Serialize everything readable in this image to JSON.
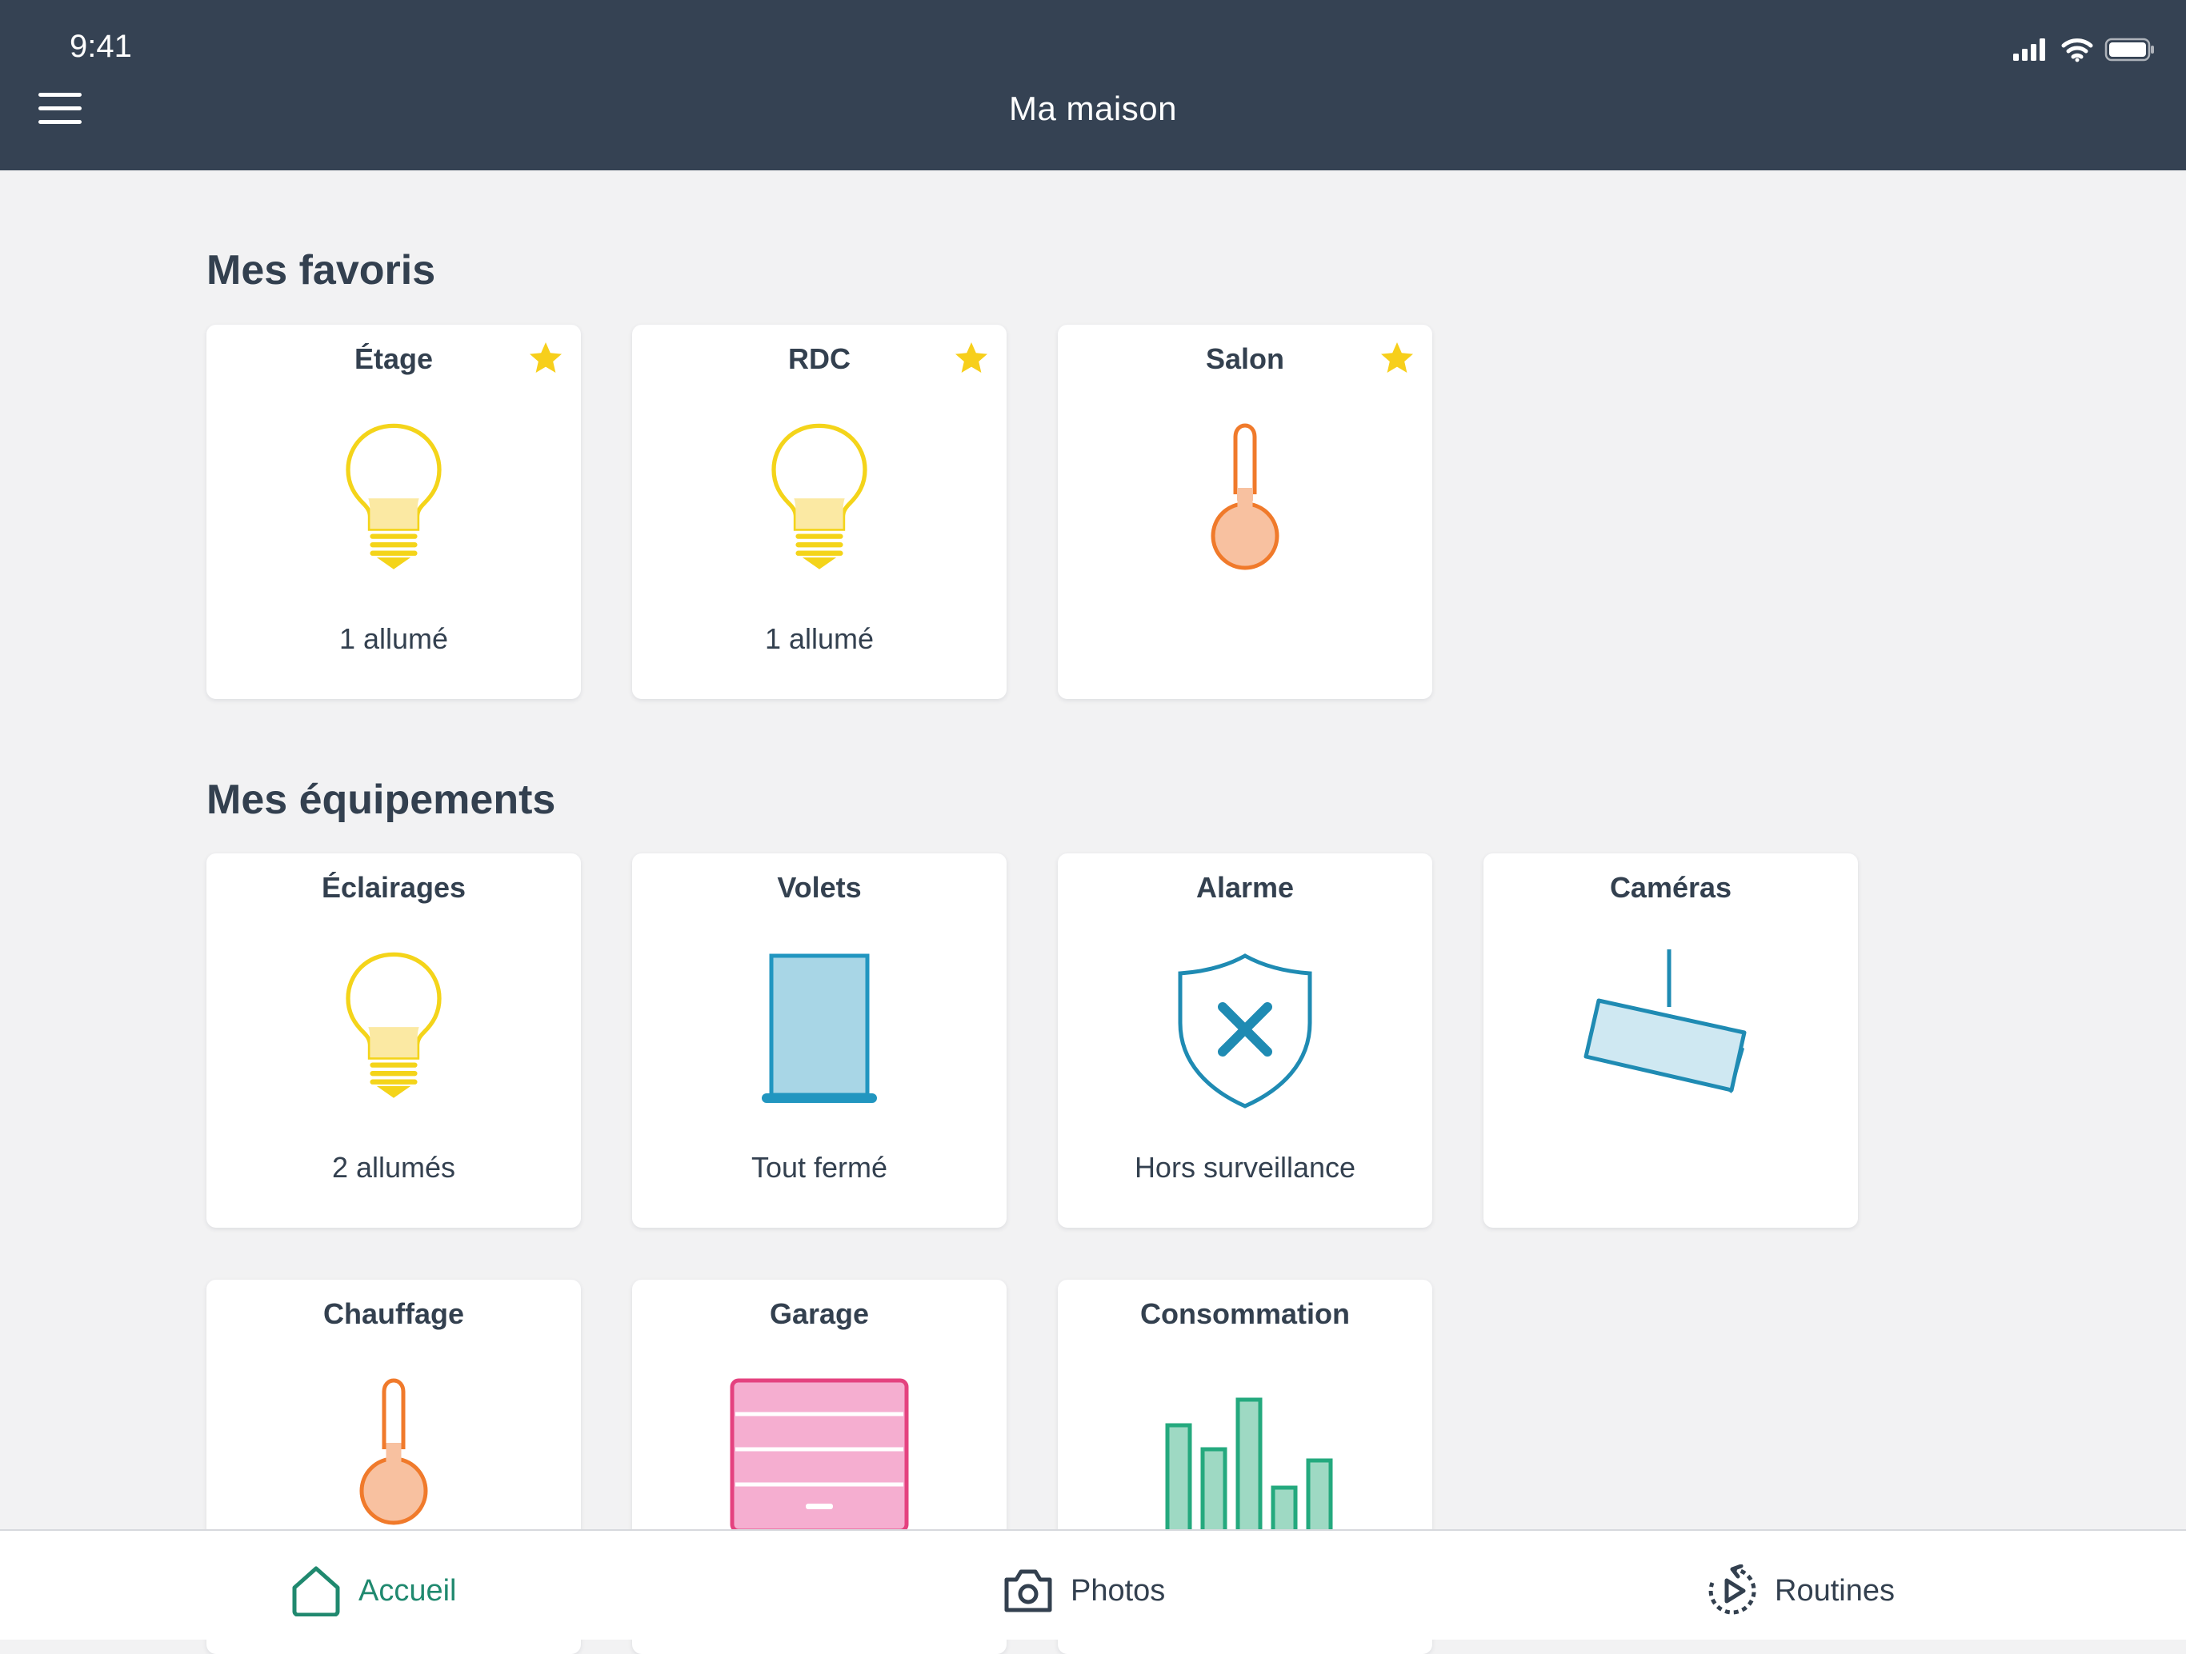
{
  "status_bar": {
    "time": "9:41"
  },
  "header": {
    "title": "Ma maison"
  },
  "favorites": {
    "title": "Mes favoris",
    "cards": [
      {
        "title": "Étage",
        "status": "1 allumé",
        "icon": "lightbulb-icon",
        "favorite": true
      },
      {
        "title": "RDC",
        "status": "1 allumé",
        "icon": "lightbulb-icon",
        "favorite": true
      },
      {
        "title": "Salon",
        "status": "",
        "icon": "thermometer-icon",
        "favorite": true
      }
    ]
  },
  "equipment": {
    "title": "Mes équipements",
    "cards": [
      {
        "title": "Éclairages",
        "status": "2 allumés",
        "icon": "lightbulb-icon"
      },
      {
        "title": "Volets",
        "status": "Tout fermé",
        "icon": "shutter-icon"
      },
      {
        "title": "Alarme",
        "status": "Hors surveillance",
        "icon": "shield-x-icon"
      },
      {
        "title": "Caméras",
        "status": "",
        "icon": "camera-icon"
      },
      {
        "title": "Chauffage",
        "status": "",
        "icon": "thermometer-icon"
      },
      {
        "title": "Garage",
        "status": "",
        "icon": "garage-door-icon"
      },
      {
        "title": "Consommation",
        "status": "",
        "icon": "bar-chart-icon"
      }
    ]
  },
  "tabs": [
    {
      "label": "Accueil",
      "icon": "home-icon",
      "active": true
    },
    {
      "label": "Photos",
      "icon": "camera-icon"
    },
    {
      "label": "Routines",
      "icon": "routine-play-icon"
    }
  ],
  "colors": {
    "header_bg": "#354253",
    "page_bg": "#f2f2f3",
    "text": "#33404f",
    "active_tab": "#20896f",
    "bulb": "#f4d41a",
    "thermo": "#f07a2b",
    "shutter": "#2196c0",
    "alarm": "#1f8bb3",
    "garage": "#e4427f",
    "consumption": "#24a97e",
    "star": "#f7cf1b"
  }
}
